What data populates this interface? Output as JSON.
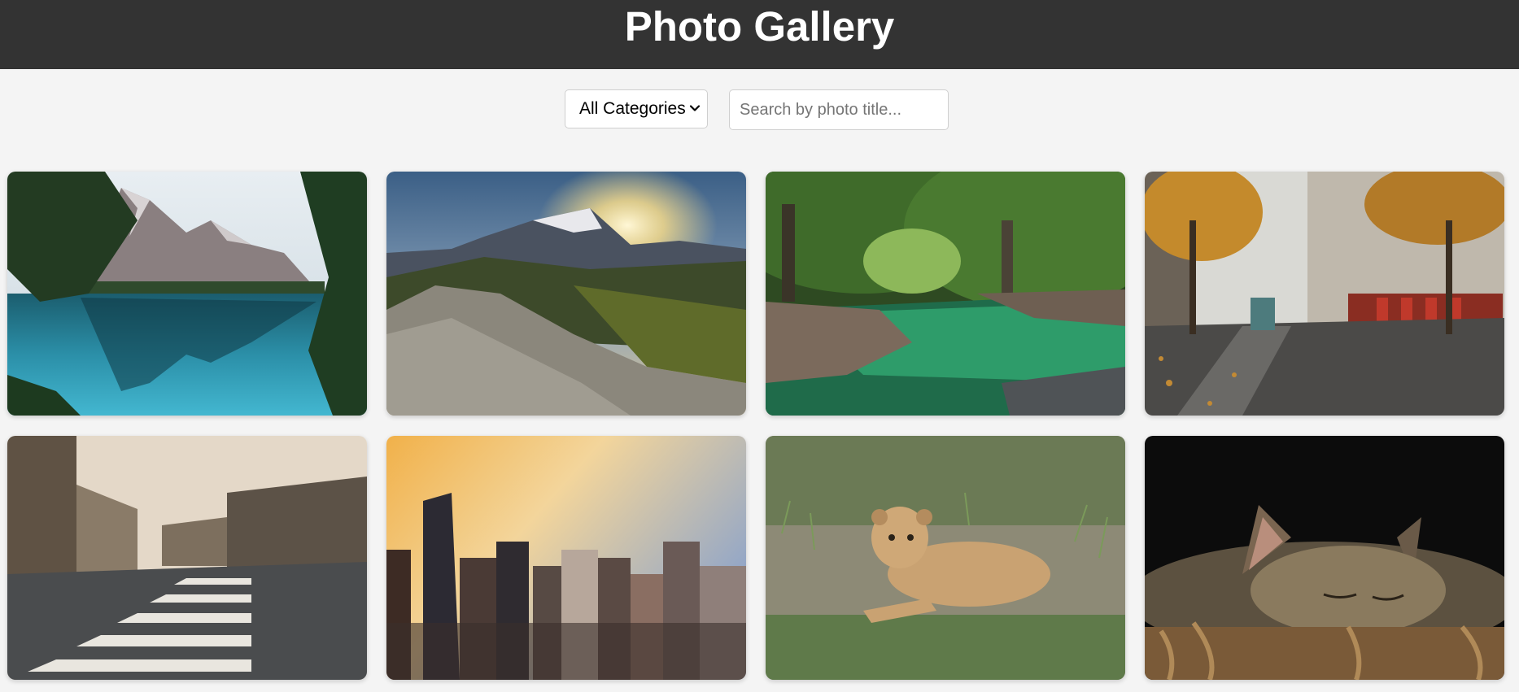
{
  "header": {
    "title": "Photo Gallery"
  },
  "filters": {
    "category_selected": "All Categories",
    "search_placeholder": "Search by photo title...",
    "search_value": ""
  },
  "photos": [
    {
      "subject": "mountain lake reflection",
      "icon": "photo-mountain-lake"
    },
    {
      "subject": "mountain sunset",
      "icon": "photo-mountain-sunset"
    },
    {
      "subject": "forest river",
      "icon": "photo-forest-river"
    },
    {
      "subject": "autumn city street with tram",
      "icon": "photo-autumn-street"
    },
    {
      "subject": "city crosswalk",
      "icon": "photo-crosswalk"
    },
    {
      "subject": "city skyline at sunset",
      "icon": "photo-skyline"
    },
    {
      "subject": "lion cub in grass",
      "icon": "photo-lion-cub"
    },
    {
      "subject": "sleeping cat",
      "icon": "photo-sleeping-cat"
    }
  ],
  "colors": {
    "header_bg": "#333333",
    "page_bg": "#f4f4f4"
  }
}
